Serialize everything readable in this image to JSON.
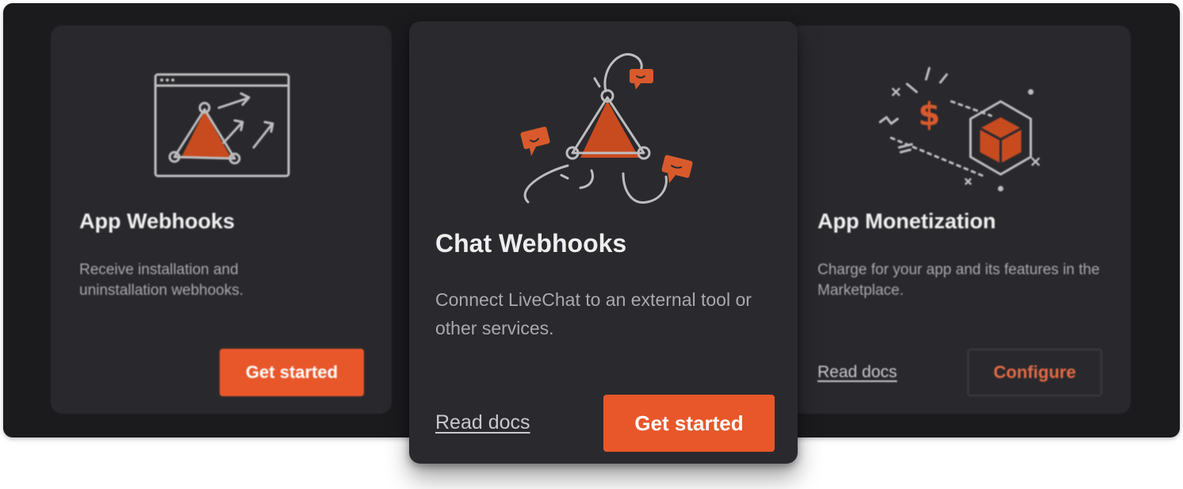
{
  "cards": [
    {
      "title": "App Webhooks",
      "description": "Receive installation and uninstallation webhooks.",
      "primary_button": "Get started"
    },
    {
      "title": "Chat Webhooks",
      "description": "Connect LiveChat to an external tool or other services.",
      "link": "Read docs",
      "primary_button": "Get started"
    },
    {
      "title": "App Monetization",
      "description": "Charge for your app and its features in the Marketplace.",
      "link": "Read docs",
      "secondary_button": "Configure"
    }
  ],
  "colors": {
    "accent": "#e8572a",
    "panel_bg": "#1b1b1e",
    "card_bg": "#29292d",
    "text_muted": "#a9a9ad"
  }
}
